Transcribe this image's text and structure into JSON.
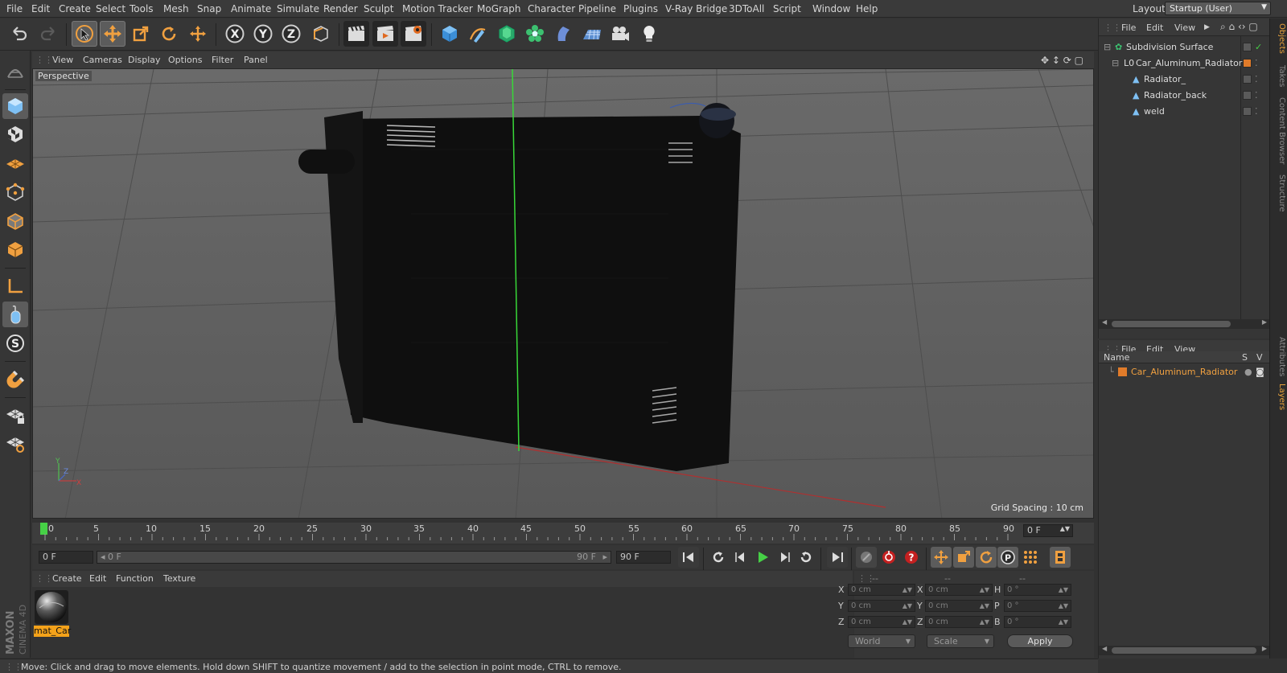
{
  "menubar": {
    "items": [
      "File",
      "Edit",
      "Create",
      "Select",
      "Tools",
      "Mesh",
      "Snap",
      "Animate",
      "Simulate",
      "Render",
      "Sculpt",
      "Motion Tracker",
      "MoGraph",
      "Character",
      "Pipeline",
      "Plugins",
      "V-Ray Bridge",
      "3DToAll",
      "Script",
      "Window",
      "Help"
    ],
    "layout_label": "Layout:",
    "layout_value": "Startup (User)"
  },
  "viewport": {
    "menu": [
      "View",
      "Cameras",
      "Display",
      "Options",
      "Filter",
      "Panel"
    ],
    "label": "Perspective",
    "grid_spacing": "Grid Spacing : 10 cm",
    "axis_labels": {
      "y": "Y",
      "z": "Z",
      "x": "X"
    }
  },
  "timeline": {
    "ticks": [
      "0",
      "5",
      "10",
      "15",
      "20",
      "25",
      "30",
      "35",
      "40",
      "45",
      "50",
      "55",
      "60",
      "65",
      "70",
      "75",
      "80",
      "85",
      "90"
    ],
    "current_frame": "0 F"
  },
  "transport": {
    "start_field": "0 F",
    "range_start": "0 F",
    "range_end": "90 F",
    "end_field": "90 F"
  },
  "material_panel": {
    "menu": [
      "Create",
      "Edit",
      "Function",
      "Texture"
    ],
    "material_name": "mat_Car"
  },
  "coordinates": {
    "headers": [
      "--",
      "--",
      "--"
    ],
    "rows": [
      {
        "l1": "X",
        "v1": "0 cm",
        "l2": "X",
        "v2": "0 cm",
        "l3": "H",
        "v3": "0 °"
      },
      {
        "l1": "Y",
        "v1": "0 cm",
        "l2": "Y",
        "v2": "0 cm",
        "l3": "P",
        "v3": "0 °"
      },
      {
        "l1": "Z",
        "v1": "0 cm",
        "l2": "Z",
        "v2": "0 cm",
        "l3": "B",
        "v3": "0 °"
      }
    ],
    "mode_world": "World",
    "mode_scale": "Scale",
    "apply": "Apply"
  },
  "status": "Move: Click and drag to move elements. Hold down SHIFT to quantize movement / add to the selection in point mode, CTRL to remove.",
  "brand": {
    "maxon": "MAXON",
    "product": "CINEMA 4D"
  },
  "objects_panel": {
    "menu": [
      "File",
      "Edit",
      "View"
    ],
    "objects": [
      {
        "name": "Subdivision Surface",
        "indent": 0
      },
      {
        "name": "Car_Aluminum_Radiator",
        "indent": 1
      },
      {
        "name": "Radiator_",
        "indent": 2
      },
      {
        "name": "Radiator_back",
        "indent": 2
      },
      {
        "name": "weld",
        "indent": 2
      }
    ]
  },
  "layers_panel": {
    "menu": [
      "File",
      "Edit",
      "View"
    ],
    "col_name": "Name",
    "col_s": "S",
    "col_v": "V",
    "layer_name": "Car_Aluminum_Radiator"
  },
  "right_tabs": {
    "top": [
      "Objects",
      "Takes",
      "Content Browser",
      "Structure"
    ],
    "bottom": [
      "Attributes",
      "Layers"
    ]
  },
  "colors": {
    "accent": "#f4a21a",
    "layer": "#e07b2a",
    "highlight": "#f0a040"
  }
}
